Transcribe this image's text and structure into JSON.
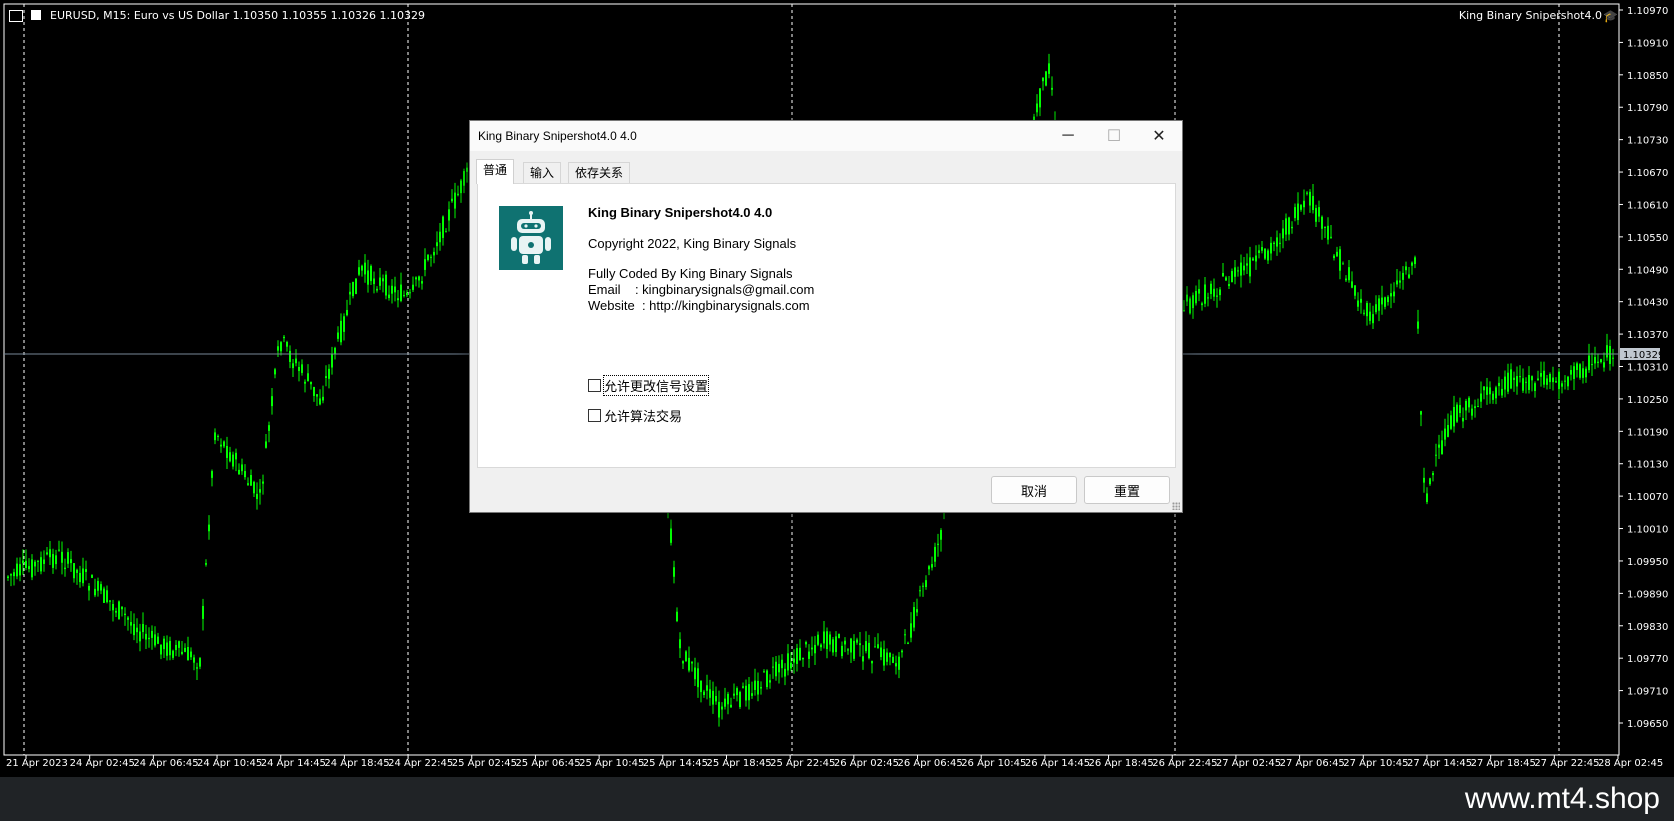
{
  "chart": {
    "symbol_info": "EURUSD, M15:  Euro vs US Dollar  1.10350 1.10355 1.10326 1.10329",
    "ea_label": "King Binary Snipershot4.0",
    "ea_icon": "graduation-cap-icon",
    "current_price": "1.10329",
    "price_levels": [
      "1.10970",
      "1.10910",
      "1.10850",
      "1.10790",
      "1.10730",
      "1.10670",
      "1.10610",
      "1.10550",
      "1.10490",
      "1.10430",
      "1.10370",
      "1.10310",
      "1.10250",
      "1.10190",
      "1.10130",
      "1.10070",
      "1.10010",
      "1.09950",
      "1.09890",
      "1.09830",
      "1.09770",
      "1.09710",
      "1.09650"
    ],
    "time_labels": [
      "21 Apr 2023",
      "24 Apr 02:45",
      "24 Apr 06:45",
      "24 Apr 10:45",
      "24 Apr 14:45",
      "24 Apr 18:45",
      "24 Apr 22:45",
      "25 Apr 02:45",
      "25 Apr 06:45",
      "25 Apr 10:45",
      "25 Apr 14:45",
      "25 Apr 18:45",
      "25 Apr 22:45",
      "26 Apr 02:45",
      "26 Apr 06:45",
      "26 Apr 10:45",
      "26 Apr 14:45",
      "26 Apr 18:45",
      "26 Apr 22:45",
      "27 Apr 02:45",
      "27 Apr 06:45",
      "27 Apr 10:45",
      "27 Apr 14:45",
      "27 Apr 18:45",
      "27 Apr 22:45",
      "28 Apr 02:45"
    ],
    "colors": {
      "bars": "#00ff00",
      "background": "#000000",
      "grid": "#ffffff",
      "price_line": "#778899"
    }
  },
  "watermark": "www.mt4.shop",
  "dialog": {
    "title": "King Binary Snipershot4.0 4.0",
    "controls": {
      "minimize": "─",
      "maximize": "☐",
      "close": "✕"
    },
    "tabs": [
      "普通",
      "输入",
      "依存关系"
    ],
    "active_tab": 0,
    "logo_icon": "robot-icon",
    "name": "King Binary Snipershot4.0 4.0",
    "copyright": "Copyright 2022, King Binary Signals",
    "coded_by": "Fully Coded By King Binary Signals",
    "email_line": "Email    : kingbinarysignals@gmail.com",
    "website_line": "Website  : http://kingbinarysignals.com",
    "checkbox_modify_signals": "允许更改信号设置",
    "checkbox_algo_trading": "允许算法交易",
    "button_cancel": "取消",
    "button_reset": "重置"
  }
}
